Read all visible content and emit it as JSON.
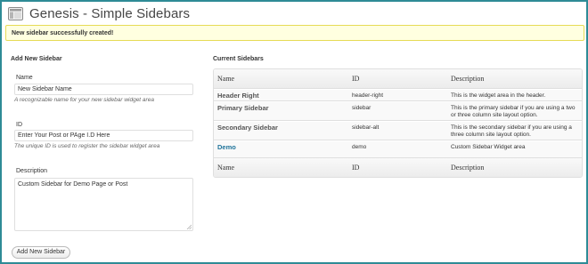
{
  "header": {
    "title": "Genesis - Simple Sidebars",
    "icon": "layout-icon"
  },
  "notice": {
    "text": "New sidebar successfully created!"
  },
  "add_form": {
    "heading": "Add New Sidebar",
    "name": {
      "label": "Name",
      "value": "New Sidebar Name",
      "description": "A recognizable name for your new sidebar widget area"
    },
    "id": {
      "label": "ID",
      "value": "Enter Your Post or PAge I.D Here",
      "description": "The unique ID is used to register the sidebar widget area"
    },
    "description": {
      "label": "Description",
      "value": "Custom Sidebar for Demo Page or Post"
    },
    "submit_label": "Add New Sidebar"
  },
  "current": {
    "heading": "Current Sidebars",
    "columns": [
      "Name",
      "ID",
      "Description"
    ],
    "rows": [
      {
        "name": "Header Right",
        "id": "header-right",
        "description": "This is the widget area in the header."
      },
      {
        "name": "Primary Sidebar",
        "id": "sidebar",
        "description": "This is the primary sidebar if you are using a two or three column site layout option."
      },
      {
        "name": "Secondary Sidebar",
        "id": "sidebar-alt",
        "description": "This is the secondary sidebar if you are using a three column site layout option."
      },
      {
        "name": "Demo",
        "id": "demo",
        "description": "Custom Sidebar Widget area"
      }
    ]
  },
  "colors": {
    "frame_border": "#2e8b96",
    "notice_bg": "#ffffe0",
    "notice_border": "#e6db55",
    "link": "#21759b"
  }
}
